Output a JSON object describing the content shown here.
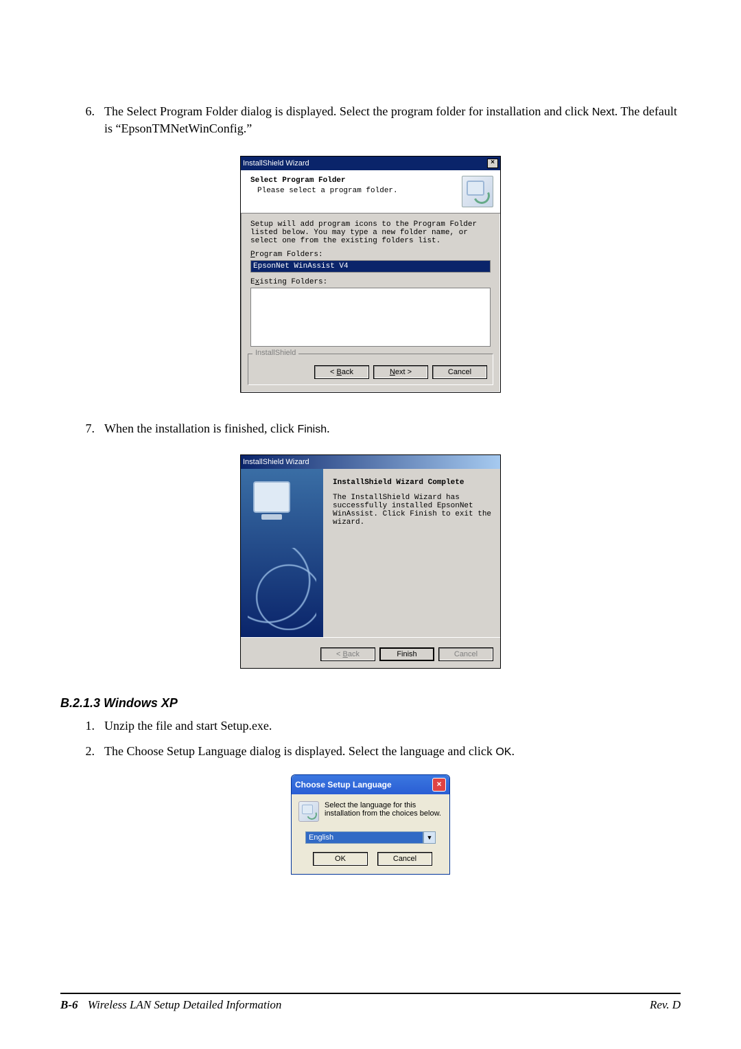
{
  "step6": {
    "num": "6.",
    "text_a": "The Select Program Folder dialog is displayed. Select the program folder for installation and click ",
    "text_next": "Next",
    "text_b": ". The default is “EpsonTMNetWinConfig.”"
  },
  "dialog1": {
    "title": "InstallShield Wizard",
    "heading": "Select Program Folder",
    "sub": "Please select a program folder.",
    "desc": "Setup will add program icons to the Program Folder listed below.  You may type a new folder name, or select one from the existing folders list.",
    "pf_label_pre": "",
    "pf_label": "Program Folders:",
    "pf_value": "EpsonNet WinAssist V4",
    "ef_label": "Existing Folders:",
    "brand": "InstallShield",
    "back": "< Back",
    "next": "Next >",
    "cancel": "Cancel"
  },
  "step7": {
    "num": "7.",
    "text_a": "When the installation is finished, click ",
    "text_finish": "Finish",
    "text_b": "."
  },
  "dialog2": {
    "title": "InstallShield Wizard",
    "heading": "InstallShield Wizard Complete",
    "body": "The InstallShield Wizard has successfully installed EpsonNet WinAssist.  Click Finish to exit the wizard.",
    "back": "< Back",
    "finish": "Finish",
    "cancel": "Cancel"
  },
  "section": {
    "heading": "B.2.1.3  Windows XP"
  },
  "xp_step1": {
    "num": "1.",
    "text": "Unzip the file and start Setup.exe."
  },
  "xp_step2": {
    "num": "2.",
    "text_a": "The Choose Setup Language dialog is displayed. Select the language and click ",
    "text_ok": "OK",
    "text_b": "."
  },
  "dialog3": {
    "title": "Choose Setup Language",
    "instr": "Select the language for this installation from the choices below.",
    "language": "English",
    "ok": "OK",
    "cancel": "Cancel"
  },
  "footer": {
    "page": "B-6",
    "title": "Wireless LAN Setup Detailed Information",
    "rev": "Rev. D"
  }
}
